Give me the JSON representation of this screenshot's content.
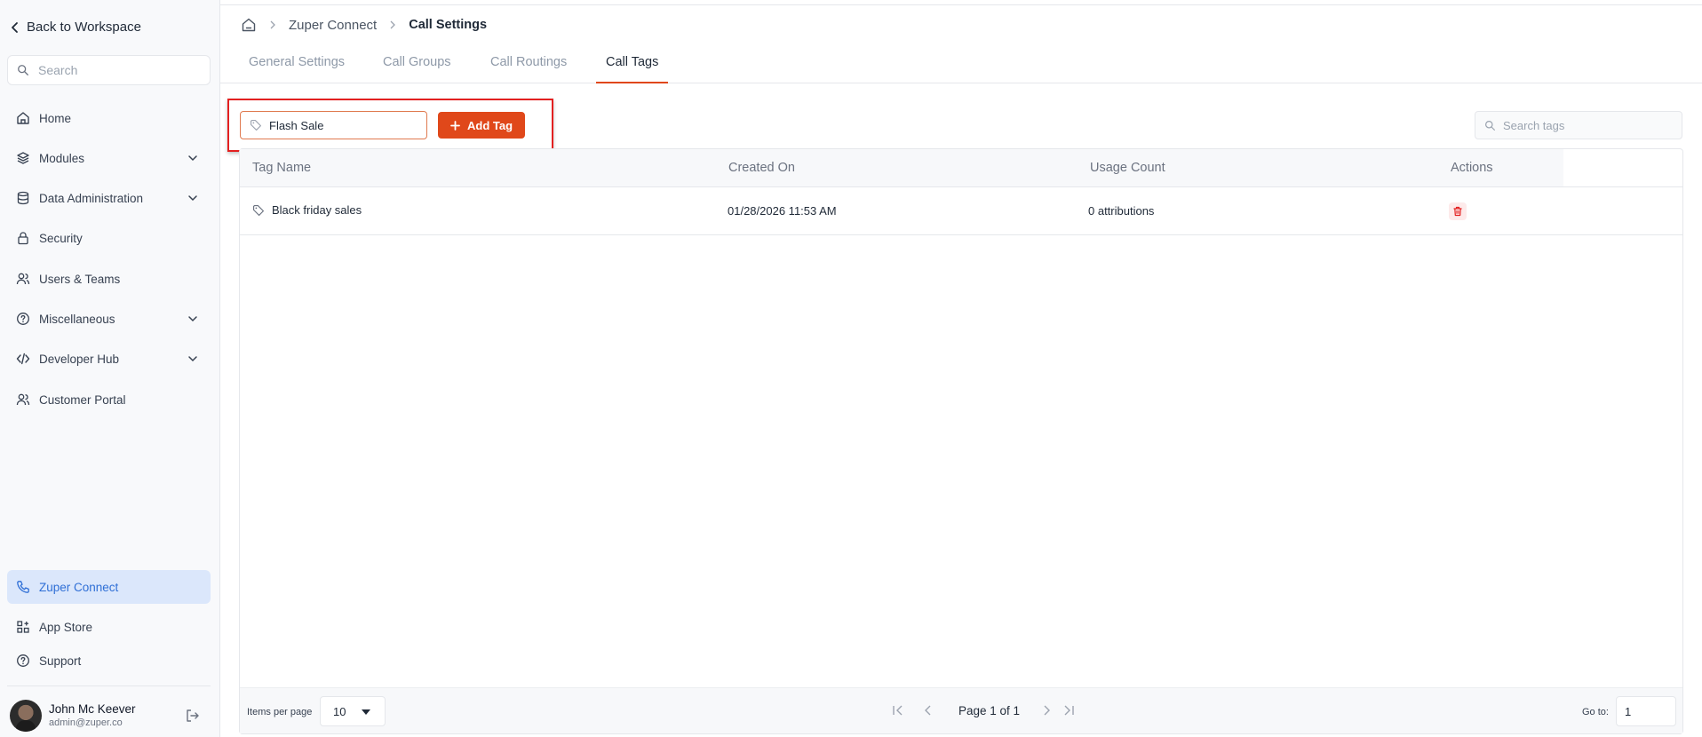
{
  "sidebar": {
    "back_label": "Back to Workspace",
    "search_placeholder": "Search",
    "items": [
      {
        "label": "Home",
        "icon": "home-icon"
      },
      {
        "label": "Modules",
        "icon": "layers-icon",
        "expandable": true
      },
      {
        "label": "Data Administration",
        "icon": "database-icon",
        "expandable": true
      },
      {
        "label": "Security",
        "icon": "lock-icon"
      },
      {
        "label": "Users & Teams",
        "icon": "users-icon"
      },
      {
        "label": "Miscellaneous",
        "icon": "help-circle-icon",
        "expandable": true
      },
      {
        "label": "Developer Hub",
        "icon": "code-icon",
        "expandable": true
      },
      {
        "label": "Customer Portal",
        "icon": "users-icon"
      }
    ],
    "bottom_items": [
      {
        "label": "Zuper Connect",
        "icon": "phone-icon",
        "active": true
      },
      {
        "label": "App Store",
        "icon": "apps-icon"
      },
      {
        "label": "Support",
        "icon": "help-circle-icon"
      }
    ],
    "user": {
      "name": "John Mc Keever",
      "email": "admin@zuper.co"
    }
  },
  "breadcrumb": {
    "items": [
      "Zuper Connect",
      "Call Settings"
    ]
  },
  "tabs": [
    {
      "label": "General Settings"
    },
    {
      "label": "Call Groups"
    },
    {
      "label": "Call Routings"
    },
    {
      "label": "Call Tags",
      "active": true
    }
  ],
  "toolbar": {
    "tag_input_value": "Flash Sale",
    "add_tag_label": "Add Tag",
    "search_placeholder": "Search tags"
  },
  "table": {
    "columns": [
      "Tag Name",
      "Created On",
      "Usage Count",
      "Actions"
    ],
    "rows": [
      {
        "tag_name": "Black friday sales",
        "created_on": "01/28/2026 11:53 AM",
        "usage_count": "0 attributions"
      }
    ]
  },
  "pagination": {
    "items_per_page_label": "Items per page",
    "items_per_page": "10",
    "page_text": "Page 1 of 1",
    "goto_label": "Go to:",
    "goto_value": "1"
  },
  "colors": {
    "accent": "#e0481a",
    "active_nav_bg": "#dbe7fb",
    "active_nav_text": "#2f6fd6",
    "highlight_border": "#e32020"
  }
}
